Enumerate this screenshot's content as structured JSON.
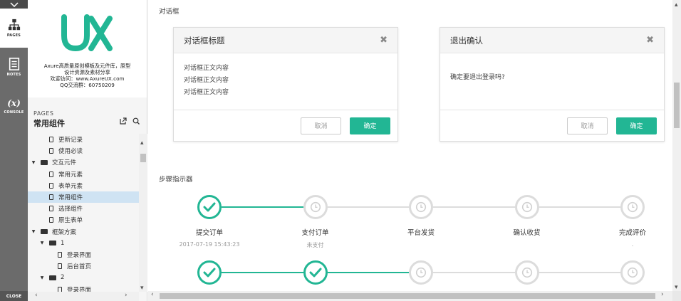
{
  "rail": {
    "pages_label": "PAGES",
    "notes_label": "NOTES",
    "console_label": "CONSOLE",
    "console_symbol": "(x)",
    "close_label": "CLOSE"
  },
  "sidebar": {
    "logo_line1": "Axure高质量原创模板及元件库，原型",
    "logo_line2": "设计资源及素材分享",
    "logo_line3": "欢迎访问：www.AxureUX.com",
    "logo_line4": "QQ交流群：60750209",
    "pages_caption": "PAGES",
    "pages_title": "常用组件",
    "tree": [
      {
        "label": "更新记录",
        "type": "page",
        "level": 2,
        "selected": false
      },
      {
        "label": "使用必读",
        "type": "page",
        "level": 2,
        "selected": false
      },
      {
        "label": "交互元件",
        "type": "folder",
        "level": 1,
        "selected": false
      },
      {
        "label": "常用元素",
        "type": "page",
        "level": 2,
        "selected": false
      },
      {
        "label": "表单元素",
        "type": "page",
        "level": 2,
        "selected": false
      },
      {
        "label": "常用组件",
        "type": "page",
        "level": 2,
        "selected": true
      },
      {
        "label": "选择组件",
        "type": "page",
        "level": 2,
        "selected": false
      },
      {
        "label": "原生表单",
        "type": "page",
        "level": 2,
        "selected": false
      },
      {
        "label": "框架方案",
        "type": "folder",
        "level": 1,
        "selected": false
      },
      {
        "label": "1",
        "type": "folder",
        "level": 2,
        "selected": false
      },
      {
        "label": "登录界面",
        "type": "page",
        "level": 3,
        "selected": false
      },
      {
        "label": "后台首页",
        "type": "page",
        "level": 3,
        "selected": false
      },
      {
        "label": "2",
        "type": "folder",
        "level": 2,
        "selected": false
      },
      {
        "label": "登录界面",
        "type": "page",
        "level": 3,
        "selected": false
      }
    ]
  },
  "main": {
    "dialog_section_title": "对话框",
    "dialog1": {
      "title": "对话框标题",
      "lines": [
        "对话框正文内容",
        "对话框正文内容",
        "对话框正文内容"
      ],
      "cancel": "取消",
      "ok": "确定"
    },
    "dialog2": {
      "title": "退出确认",
      "body": "确定要退出登录吗?",
      "cancel": "取消",
      "ok": "确定"
    },
    "close_symbol": "✖",
    "steps_section_title": "步骤指示器",
    "steps_row1": [
      {
        "name": "提交订单",
        "sub": "2017-07-19 15:43:23",
        "status": "done"
      },
      {
        "name": "支付订单",
        "sub": "未支付",
        "status": "todo"
      },
      {
        "name": "平台发货",
        "sub": "",
        "status": "todo"
      },
      {
        "name": "确认收货",
        "sub": "",
        "status": "todo"
      },
      {
        "name": "完成评价",
        "sub": ".",
        "status": "todo"
      }
    ],
    "steps_row2": [
      {
        "status": "done"
      },
      {
        "status": "done"
      },
      {
        "status": "todo"
      },
      {
        "status": "todo"
      },
      {
        "status": "todo"
      }
    ]
  },
  "colors": {
    "accent": "#22b694",
    "rail": "#6b6b6b",
    "selected_row": "#cfe3f3",
    "pending_line": "#dcdcdc"
  }
}
